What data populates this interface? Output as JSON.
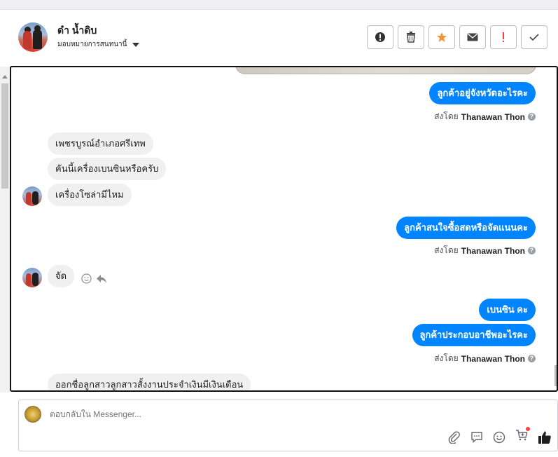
{
  "header": {
    "contact_name": "ดำ น้ำดิบ",
    "assign_label": "มอบหมายการสนทนานี้"
  },
  "actions": [
    {
      "name": "alert-circle-button",
      "glyph": "❗"
    },
    {
      "name": "trash-button",
      "glyph": "🗑"
    },
    {
      "name": "star-button",
      "glyph": "★"
    },
    {
      "name": "mail-button",
      "glyph": "✉"
    },
    {
      "name": "spam-button",
      "glyph": "!"
    },
    {
      "name": "done-button",
      "glyph": "✓"
    }
  ],
  "messages": {
    "m1": "ลูกค้าอยู่จังหวัดอะไรคะ",
    "m2": "เพชรบูรณ์อำเภอศรีเทพ",
    "m3": "คันนี้เครื่องเบนซินหรือครับ",
    "m4": "เครื่องโซล่ามีไหม",
    "m5": "ลูกค้าสนใจซื้อสดหรือจัดแนนคะ",
    "m6": "จัด",
    "m7": "เบนซิน คะ",
    "m8": "ลูกค้าประกอบอาชีพอะไรคะ",
    "m9": "ออกชื่อลูกสาวลูกสาวสั้งงานประจำเงินมีเงินเดือน"
  },
  "sent_by": {
    "prefix": "ส่งโดย",
    "agent": "Thanawan Thon"
  },
  "composer": {
    "placeholder": "ตอบกลับใน Messenger..."
  },
  "colors": {
    "accent": "#0084ff",
    "incoming_bubble": "#f0f0f0",
    "star": "#f7923a",
    "spam": "#fa3e3e"
  }
}
